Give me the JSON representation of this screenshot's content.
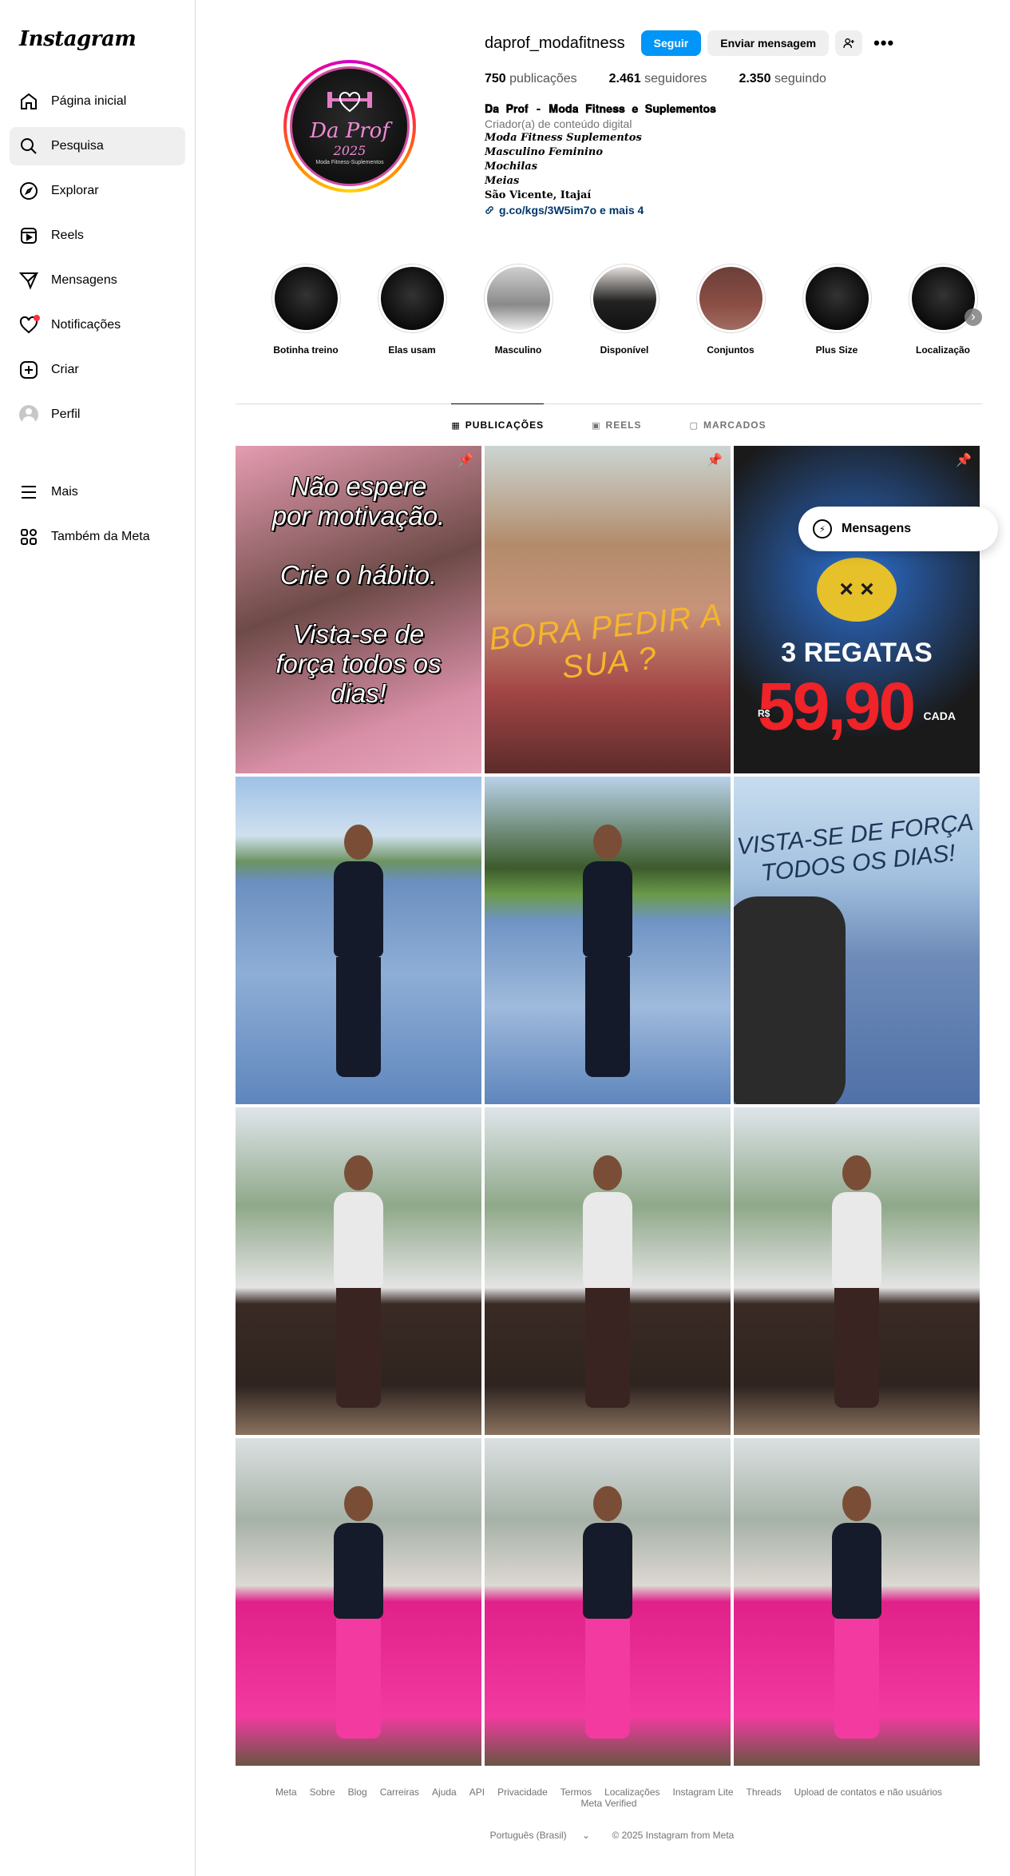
{
  "app": {
    "logo": "Instagram"
  },
  "sidebar": {
    "items": [
      {
        "label": "Página inicial",
        "icon": "home-icon"
      },
      {
        "label": "Pesquisa",
        "icon": "search-icon"
      },
      {
        "label": "Explorar",
        "icon": "compass-icon"
      },
      {
        "label": "Reels",
        "icon": "reels-icon"
      },
      {
        "label": "Mensagens",
        "icon": "send-icon"
      },
      {
        "label": "Notificações",
        "icon": "heart-icon"
      },
      {
        "label": "Criar",
        "icon": "plus-square-icon"
      },
      {
        "label": "Perfil",
        "icon": "avatar"
      }
    ],
    "bottom": [
      {
        "label": "Mais",
        "icon": "menu-icon"
      },
      {
        "label": "Também da Meta",
        "icon": "meta-grid-icon"
      }
    ]
  },
  "profile": {
    "username": "daprof_modafitness",
    "follow_label": "Seguir",
    "message_label": "Enviar mensagem",
    "avatar": {
      "brand": "Da Prof",
      "year": "2025",
      "tagline": "Moda Fitness-Suplementos"
    },
    "stats": {
      "posts_value": "750",
      "posts_label": "publicações",
      "followers_value": "2.461",
      "followers_label": "seguidores",
      "following_value": "2.350",
      "following_label": "seguindo"
    },
    "bio": {
      "name": "𝐃𝐚 𝐏𝐫𝐨𝐟 - 𝐌𝐨𝐝𝐚 𝐅𝐢𝐭𝐧𝐞𝐬𝐬 𝐞 𝐒𝐮𝐩𝐥𝐞𝐦𝐞𝐧𝐭𝐨𝐬",
      "category": "Criador(a) de conteúdo digital",
      "lines": [
        "Moda Fitness Suplementos",
        "Masculino Feminino",
        "Mochilas",
        "Meias"
      ],
      "city": "São Vicente, Itajaí",
      "link": "g.co/kgs/3W5im7o e mais 4"
    }
  },
  "highlights": [
    {
      "label": "Botinha treino",
      "style": "hl-logo"
    },
    {
      "label": "Elas usam",
      "style": "hl-logo"
    },
    {
      "label": "Masculino",
      "style": "hl-man"
    },
    {
      "label": "Disponível",
      "style": "hl-woman"
    },
    {
      "label": "Conjuntos",
      "style": "hl-set"
    },
    {
      "label": "Plus Size",
      "style": "hl-logo"
    },
    {
      "label": "Localização",
      "style": "hl-logo"
    }
  ],
  "tabs": [
    {
      "label": "PUBLICAÇÕES",
      "icon": "grid-icon",
      "active": true
    },
    {
      "label": "REELS",
      "icon": "reels-icon",
      "active": false
    },
    {
      "label": "MARCADOS",
      "icon": "tagged-icon",
      "active": false
    }
  ],
  "posts": {
    "p1_text": "Não espere por motivação. Crie o hábito. Vista-se de força todos os dias!",
    "p1_line1": "Não espere",
    "p1_line2": "por motivação.",
    "p1_line3": "Crie o hábito.",
    "p1_line4": "Vista-se de",
    "p1_line5": "força todos os",
    "p1_line6": "dias!",
    "p2_text": "BORA PEDIR A SUA ?",
    "p3_line1": "3 REGATAS",
    "p3_price": "59,90",
    "p3_currency": "R$",
    "p3_unit": "CADA",
    "p6_line1": "VISTA-SE DE FORÇA",
    "p6_line2": "TODOS OS DIAS!"
  },
  "popup": {
    "label": "Mensagens"
  },
  "footer": {
    "links": [
      "Meta",
      "Sobre",
      "Blog",
      "Carreiras",
      "Ajuda",
      "API",
      "Privacidade",
      "Termos",
      "Localizações",
      "Instagram Lite",
      "Threads",
      "Upload de contatos e não usuários",
      "Meta Verified"
    ],
    "language": "Português (Brasil)",
    "copyright": "© 2025 Instagram from Meta"
  }
}
